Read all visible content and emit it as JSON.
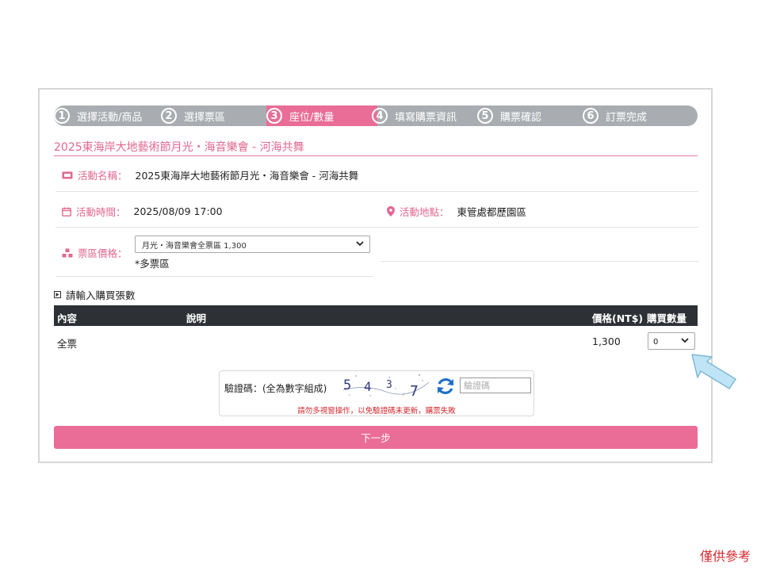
{
  "steps": [
    {
      "number": "1",
      "label": "選擇活動/商品"
    },
    {
      "number": "2",
      "label": "選擇票區"
    },
    {
      "number": "3",
      "label": "座位/數量"
    },
    {
      "number": "4",
      "label": "填寫購票資訊"
    },
    {
      "number": "5",
      "label": "購票確認"
    },
    {
      "number": "6",
      "label": "訂票完成"
    }
  ],
  "active_step": 3,
  "event": {
    "title": "2025東海岸大地藝術節月光・海音樂會 - 河海共舞",
    "name_label": "活動名稱：",
    "name_value": "2025東海岸大地藝術節月光・海音樂會 - 河海共舞",
    "time_label": "活動時間：",
    "time_value": "2025/08/09 17:00",
    "location_label": "活動地點：",
    "location_value": "東管處都歷園區",
    "price_label": "票區價格：",
    "price_select_value": "月光・海音樂會全票區 1,300",
    "multi_zone_note": "*多票區"
  },
  "quantity_section": {
    "heading": "請輸入購買張數",
    "columns": [
      "內容",
      "說明",
      "價格(NT$)",
      "購買數量"
    ],
    "rows": [
      {
        "content": "全票",
        "description": "",
        "price": "1,300",
        "qty": "0"
      }
    ]
  },
  "captcha": {
    "label": "驗證碼：(全為數字組成)",
    "digits": [
      "5",
      "4",
      "3",
      "7"
    ],
    "input_placeholder": "驗證碼",
    "warning": "請勿多視窗操作，以免驗證碼未更新，購票失敗"
  },
  "next_button": "下一步",
  "reference_note": "僅供參考",
  "colors": {
    "accent_pink": "#e96d96",
    "step_gray": "#a9adb1",
    "table_header": "#2d3136",
    "warning_red": "#d4272c",
    "arrow_blue": "#bfe4f5"
  }
}
